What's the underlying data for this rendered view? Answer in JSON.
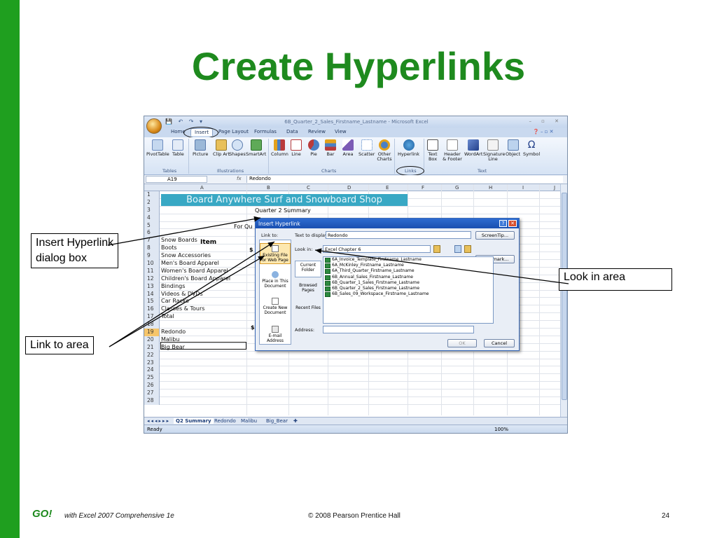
{
  "slide": {
    "title": "Create Hyperlinks",
    "footer": {
      "logo": "GO!",
      "book": "with Excel 2007 Comprehensive 1e",
      "copyright": "© 2008 Pearson Prentice Hall",
      "page": "24"
    },
    "callouts": {
      "dialog": "Insert Hyperlink\ndialog box",
      "link_to": "Link to area",
      "look_in": "Look in area"
    },
    "accent": "#1e8a1e"
  },
  "excel": {
    "window_title": "6B_Quarter_2_Sales_Firstname_Lastname - Microsoft Excel",
    "tabs": [
      "Home",
      "Insert",
      "Page Layout",
      "Formulas",
      "Data",
      "Review",
      "View"
    ],
    "ribbon": {
      "buttons": [
        "PivotTable",
        "Table",
        "Picture",
        "Clip Art",
        "Shapes",
        "SmartArt",
        "Column",
        "Line",
        "Pie",
        "Bar",
        "Area",
        "Scatter",
        "Other Charts",
        "Hyperlink",
        "Text Box",
        "Header & Footer",
        "WordArt",
        "Signature Line",
        "Object",
        "Symbol"
      ],
      "groups": [
        "Tables",
        "Illustrations",
        "Charts",
        "Links",
        "Text"
      ]
    },
    "name_box": "A19",
    "fx": "fx",
    "formula_value": "Redondo",
    "columns": [
      "A",
      "B",
      "C",
      "D",
      "E",
      "F",
      "G",
      "H",
      "I",
      "J"
    ],
    "sheet": {
      "banner": "Board Anywhere Surf and Snowboard Shop",
      "subtitle": "Quarter 2 Summary",
      "for_q": "For Qu",
      "item_header": "Item",
      "dollar": "$",
      "rows": [
        {
          "n": "1",
          "a": ""
        },
        {
          "n": "2",
          "a": ""
        },
        {
          "n": "3",
          "a": ""
        },
        {
          "n": "4",
          "a": ""
        },
        {
          "n": "5",
          "a": ""
        },
        {
          "n": "6",
          "a": ""
        },
        {
          "n": "7",
          "a": "Snow Boards"
        },
        {
          "n": "8",
          "a": "Boots"
        },
        {
          "n": "9",
          "a": "Snow Accessories"
        },
        {
          "n": "10",
          "a": "Men's Board Apparel"
        },
        {
          "n": "11",
          "a": "Women's Board Apparel"
        },
        {
          "n": "12",
          "a": "Children's Board Apparel"
        },
        {
          "n": "13",
          "a": "Bindings"
        },
        {
          "n": "14",
          "a": "Videos & DVDs"
        },
        {
          "n": "15",
          "a": "Car Racks"
        },
        {
          "n": "16",
          "a": "Classes & Tours"
        },
        {
          "n": "17",
          "a": "Total"
        },
        {
          "n": "18",
          "a": ""
        },
        {
          "n": "19",
          "a": "Redondo"
        },
        {
          "n": "20",
          "a": "Malibu"
        },
        {
          "n": "21",
          "a": "Big Bear"
        },
        {
          "n": "22",
          "a": ""
        },
        {
          "n": "23",
          "a": ""
        },
        {
          "n": "24",
          "a": ""
        },
        {
          "n": "25",
          "a": ""
        },
        {
          "n": "26",
          "a": ""
        },
        {
          "n": "27",
          "a": ""
        },
        {
          "n": "28",
          "a": ""
        }
      ]
    },
    "sheet_tabs": [
      "Q2 Summary",
      "Redondo",
      "Malibu",
      "Big_Bear"
    ],
    "status": {
      "ready": "Ready",
      "zoom": "100%"
    }
  },
  "dialog": {
    "title": "Insert Hyperlink",
    "link_to_label": "Link to:",
    "text_to_display_label": "Text to display:",
    "text_to_display_value": "Redondo",
    "screentip": "ScreenTip...",
    "look_in_label": "Look in:",
    "look_in_value": "Excel Chapter 6",
    "bookmark": "Bookmark...",
    "link_options": [
      "Existing File or Web Page",
      "Place in This Document",
      "Create New Document",
      "E-mail Address"
    ],
    "nav": [
      "Current Folder",
      "Browsed Pages",
      "Recent Files"
    ],
    "files": [
      "6A_Invoice_Template_Firstname_Lastname",
      "6A_McKinley_Firstname_Lastname",
      "6A_Third_Quarter_Firstname_Lastname",
      "6B_Annual_Sales_Firstname_Lastname",
      "6B_Quarter_1_Sales_Firstname_Lastname",
      "6B_Quarter_2_Sales_Firstname_Lastname",
      "6B_Sales_09_Workspace_Firstname_Lastname"
    ],
    "address_label": "Address:",
    "ok": "OK",
    "cancel": "Cancel"
  }
}
